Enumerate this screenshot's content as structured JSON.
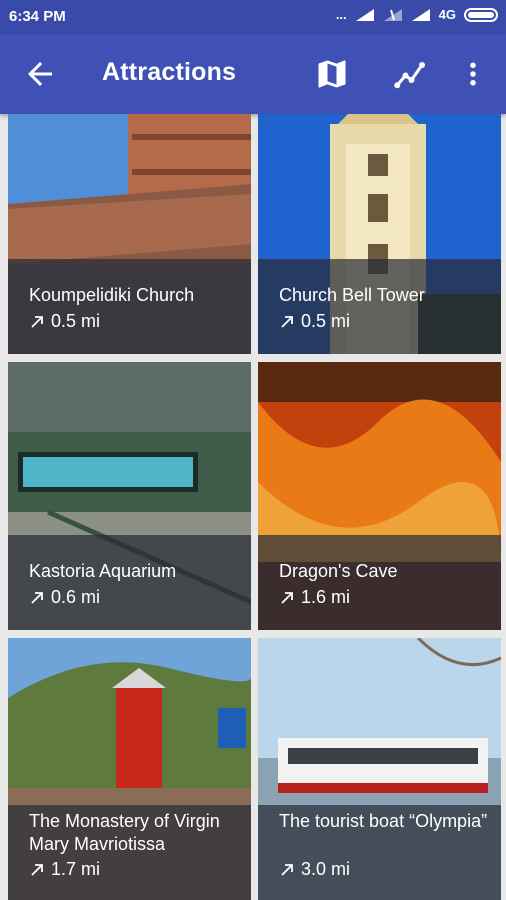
{
  "status_bar": {
    "time": "6:34 PM",
    "signal_indicators": "...",
    "network_label": "4G",
    "icons": [
      "signal-icon",
      "signal-icon",
      "signal-icon",
      "battery-icon"
    ]
  },
  "app_bar": {
    "title": "Attractions",
    "icons": [
      "back-arrow-icon",
      "map-icon",
      "route-icon",
      "overflow-menu-icon"
    ]
  },
  "attractions": [
    {
      "name": "Koumpelidiki Church",
      "distance": "0.5 mi"
    },
    {
      "name": "Church Bell Tower",
      "distance": "0.5 mi"
    },
    {
      "name": "Kastoria Aquarium",
      "distance": "0.6 mi"
    },
    {
      "name": "Dragon's Cave",
      "distance": "1.6 mi"
    },
    {
      "name": "The Monastery of Virgin Mary Mavriotissa",
      "distance": "1.7 mi"
    },
    {
      "name": "The tourist boat “Olympia”",
      "distance": "3.0 mi"
    }
  ],
  "colors": {
    "app_bar": "#3f51b5",
    "status_bar": "#3a4aa8",
    "caption_overlay": "#2a2f37"
  }
}
